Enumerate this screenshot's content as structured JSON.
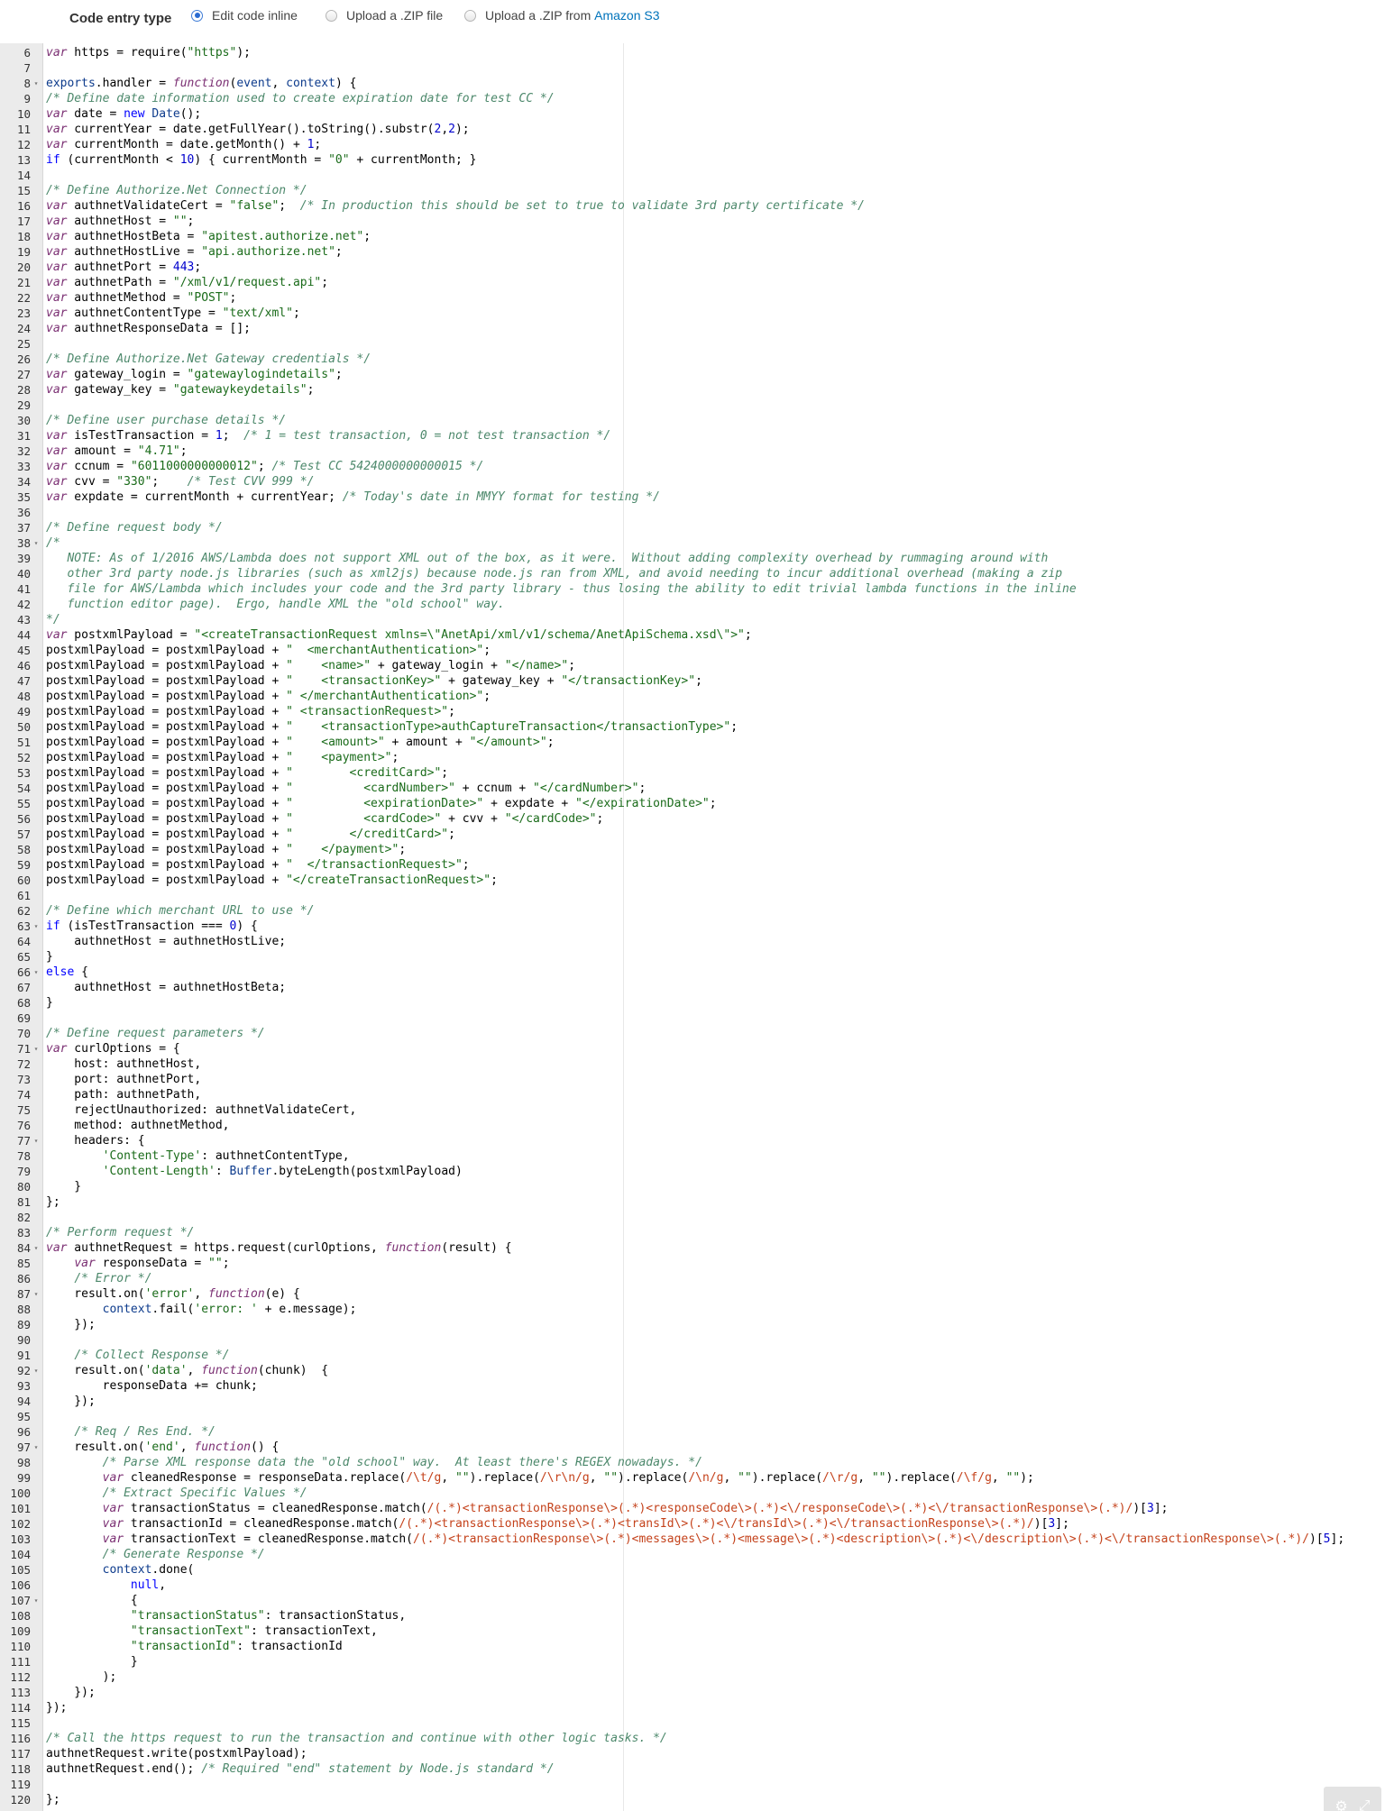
{
  "entry_type": {
    "label": "Code entry type",
    "options": [
      {
        "label": "Edit code inline",
        "selected": true
      },
      {
        "label": "Upload a .ZIP file",
        "selected": false
      },
      {
        "label": "Upload a .ZIP from ",
        "link": "Amazon S3",
        "selected": false
      }
    ]
  },
  "editor": {
    "first_line_number": 6,
    "lines": [
      "var https = require(\"https\");",
      "",
      "exports.handler = function(event, context) {",
      "/* Define date information used to create expiration date for test CC */",
      "var date = new Date();",
      "var currentYear = date.getFullYear().toString().substr(2,2);",
      "var currentMonth = date.getMonth() + 1;",
      "if (currentMonth < 10) { currentMonth = \"0\" + currentMonth; }",
      "",
      "/* Define Authorize.Net Connection */",
      "var authnetValidateCert = \"false\";  /* In production this should be set to true to validate 3rd party certificate */",
      "var authnetHost = \"\";",
      "var authnetHostBeta = \"apitest.authorize.net\";",
      "var authnetHostLive = \"api.authorize.net\";",
      "var authnetPort = 443;",
      "var authnetPath = \"/xml/v1/request.api\";",
      "var authnetMethod = \"POST\";",
      "var authnetContentType = \"text/xml\";",
      "var authnetResponseData = [];",
      "",
      "/* Define Authorize.Net Gateway credentials */",
      "var gateway_login = \"gatewaylogindetails\";",
      "var gateway_key = \"gatewaykeydetails\";",
      "",
      "/* Define user purchase details */",
      "var isTestTransaction = 1;  /* 1 = test transaction, 0 = not test transaction */",
      "var amount = \"4.71\";",
      "var ccnum = \"6011000000000012\"; /* Test CC 5424000000000015 */",
      "var cvv = \"330\";    /* Test CVV 999 */",
      "var expdate = currentMonth + currentYear; /* Today's date in MMYY format for testing */",
      "",
      "/* Define request body */",
      "/*",
      "   NOTE: As of 1/2016 AWS/Lambda does not support XML out of the box, as it were.  Without adding complexity overhead by rummaging around with",
      "   other 3rd party node.js libraries (such as xml2js) because node.js ran from XML, and avoid needing to incur additional overhead (making a zip",
      "   file for AWS/Lambda which includes your code and the 3rd party library - thus losing the ability to edit trivial lambda functions in the inline",
      "   function editor page).  Ergo, handle XML the \"old school\" way.",
      "*/",
      "var postxmlPayload = \"<createTransactionRequest xmlns=\\\"AnetApi/xml/v1/schema/AnetApiSchema.xsd\\\">\";",
      "postxmlPayload = postxmlPayload + \"  <merchantAuthentication>\";",
      "postxmlPayload = postxmlPayload + \"    <name>\" + gateway_login + \"</name>\";",
      "postxmlPayload = postxmlPayload + \"    <transactionKey>\" + gateway_key + \"</transactionKey>\";",
      "postxmlPayload = postxmlPayload + \" </merchantAuthentication>\";",
      "postxmlPayload = postxmlPayload + \" <transactionRequest>\";",
      "postxmlPayload = postxmlPayload + \"    <transactionType>authCaptureTransaction</transactionType>\";",
      "postxmlPayload = postxmlPayload + \"    <amount>\" + amount + \"</amount>\";",
      "postxmlPayload = postxmlPayload + \"    <payment>\";",
      "postxmlPayload = postxmlPayload + \"        <creditCard>\";",
      "postxmlPayload = postxmlPayload + \"          <cardNumber>\" + ccnum + \"</cardNumber>\";",
      "postxmlPayload = postxmlPayload + \"          <expirationDate>\" + expdate + \"</expirationDate>\";",
      "postxmlPayload = postxmlPayload + \"          <cardCode>\" + cvv + \"</cardCode>\";",
      "postxmlPayload = postxmlPayload + \"        </creditCard>\";",
      "postxmlPayload = postxmlPayload + \"    </payment>\";",
      "postxmlPayload = postxmlPayload + \"  </transactionRequest>\";",
      "postxmlPayload = postxmlPayload + \"</createTransactionRequest>\";",
      "",
      "/* Define which merchant URL to use */",
      "if (isTestTransaction === 0) {",
      "    authnetHost = authnetHostLive;",
      "}",
      "else {",
      "    authnetHost = authnetHostBeta;",
      "}",
      "",
      "/* Define request parameters */",
      "var curlOptions = {",
      "    host: authnetHost,",
      "    port: authnetPort,",
      "    path: authnetPath,",
      "    rejectUnauthorized: authnetValidateCert,",
      "    method: authnetMethod,",
      "    headers: {",
      "        'Content-Type': authnetContentType,",
      "        'Content-Length': Buffer.byteLength(postxmlPayload)",
      "    }",
      "};",
      "",
      "/* Perform request */",
      "var authnetRequest = https.request(curlOptions, function(result) {",
      "    var responseData = \"\";",
      "    /* Error */",
      "    result.on('error', function(e) {",
      "        context.fail('error: ' + e.message);",
      "    });",
      "",
      "    /* Collect Response */",
      "    result.on('data', function(chunk)  {",
      "        responseData += chunk;",
      "    });",
      "",
      "    /* Req / Res End. */",
      "    result.on('end', function() {",
      "        /* Parse XML response data the \"old school\" way.  At least there's REGEX nowadays. */",
      "        var cleanedResponse = responseData.replace(/\\t/g, \"\").replace(/\\r\\n/g, \"\").replace(/\\n/g, \"\").replace(/\\r/g, \"\").replace(/\\f/g, \"\");",
      "        /* Extract Specific Values */",
      "        var transactionStatus = cleanedResponse.match(/(.*)<transactionResponse\\>(.*)<responseCode\\>(.*)<\\/responseCode\\>(.*)<\\/transactionResponse\\>(.*)/)[3];",
      "        var transactionId = cleanedResponse.match(/(.*)<transactionResponse\\>(.*)<transId\\>(.*)<\\/transId\\>(.*)<\\/transactionResponse\\>(.*)/)[3];",
      "        var transactionText = cleanedResponse.match(/(.*)<transactionResponse\\>(.*)<messages\\>(.*)<message\\>(.*)<description\\>(.*)<\\/description\\>(.*)<\\/transactionResponse\\>(.*)/)[5];",
      "        /* Generate Response */",
      "        context.done(",
      "            null,",
      "            {",
      "            \"transactionStatus\": transactionStatus,",
      "            \"transactionText\": transactionText,",
      "            \"transactionId\": transactionId",
      "            }",
      "        );",
      "    });",
      "});",
      "",
      "/* Call the https request to run the transaction and continue with other logic tasks. */",
      "authnetRequest.write(postxmlPayload);",
      "authnetRequest.end(); /* Required \"end\" statement by Node.js standard */",
      "",
      "};"
    ],
    "fold_lines": [
      8,
      38,
      63,
      66,
      71,
      77,
      84,
      87,
      92,
      97,
      107
    ],
    "fold_marker": "▾",
    "colors": {
      "keyword": "#0000ff",
      "storage": "#7a2e72",
      "string": "#1a6b1a",
      "comment": "#4c886b",
      "number": "#0000cd",
      "regex": "#c4421b",
      "builtin": "#0d3b8c"
    },
    "tools": {
      "settings_icon": "⚙",
      "fullscreen_icon": "⤢"
    }
  }
}
